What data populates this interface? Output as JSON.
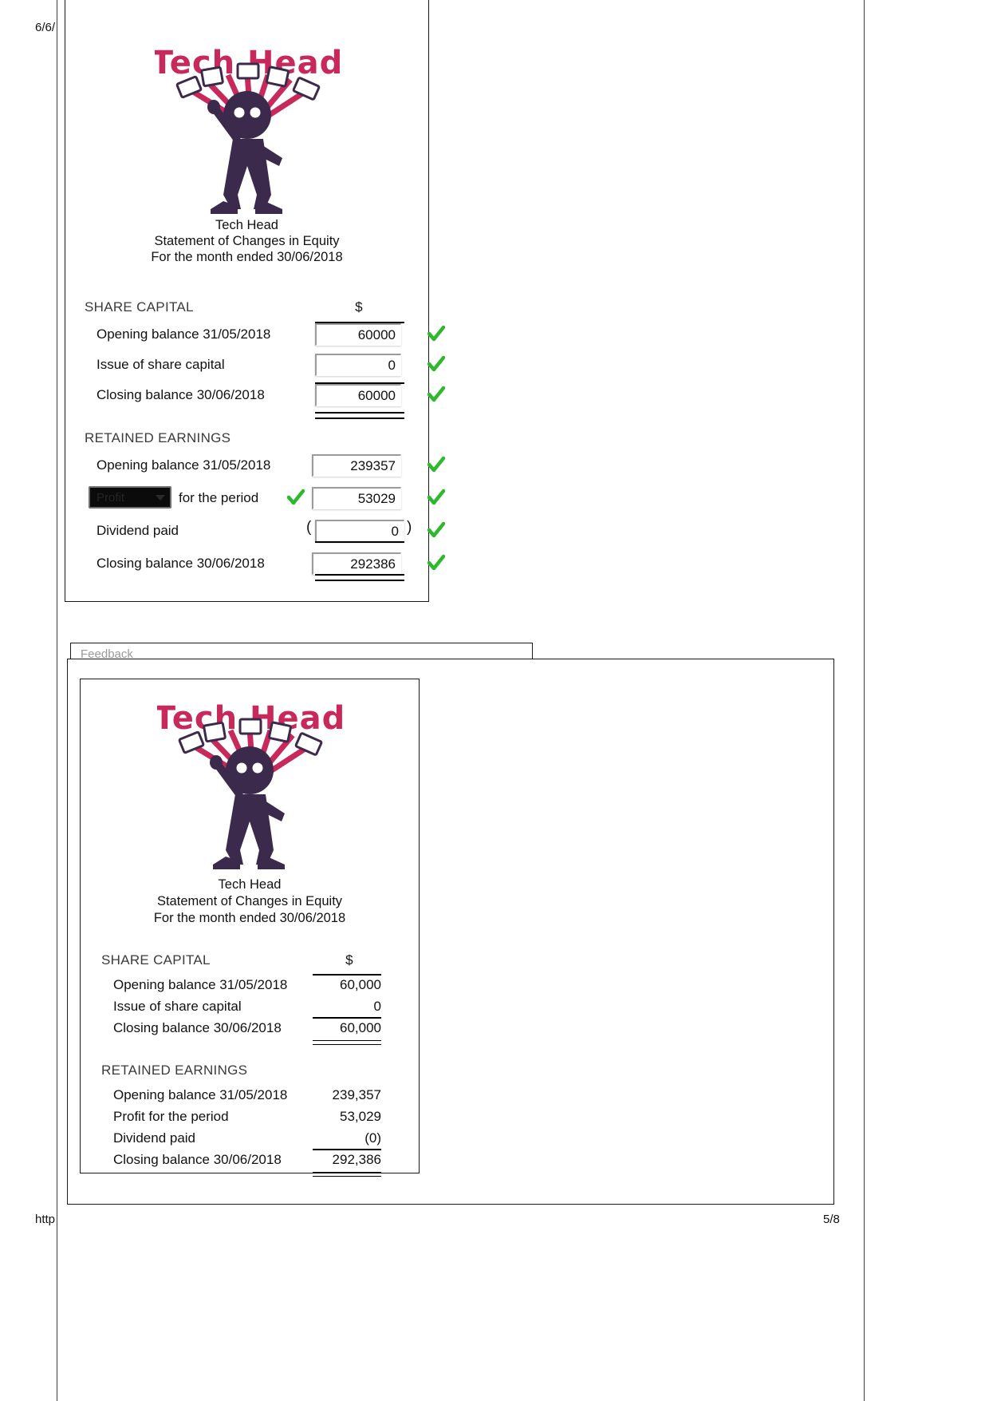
{
  "browser": {
    "header_date": "6/6/",
    "footer_url": "http",
    "page_number": "5/8"
  },
  "logo": {
    "wordmark": "Tech Head",
    "alt": "tech-head-logo"
  },
  "worksheet": {
    "title_line1": "Tech Head",
    "title_line2": "Statement of Changes in Equity",
    "title_line3": "For the month ended 30/06/2018",
    "currency_header": "$",
    "share_capital": {
      "heading": "SHARE CAPITAL",
      "rows": [
        {
          "label": "Opening balance 31/05/2018",
          "value": "60000",
          "tick": true
        },
        {
          "label": "Issue of share capital",
          "value": "0",
          "tick": true
        },
        {
          "label": "Closing balance 30/06/2018",
          "value": "60000",
          "tick": true
        }
      ]
    },
    "retained_earnings": {
      "heading": "RETAINED EARNINGS",
      "rows": [
        {
          "label": "Opening balance 31/05/2018",
          "value": "239357",
          "tick": true
        },
        {
          "label": "for the period",
          "value": "53029",
          "tick": true,
          "select_value": "Profit",
          "inline_tick": true
        },
        {
          "label": "Dividend paid",
          "value": "0",
          "tick": true,
          "parens": true
        },
        {
          "label": "Closing balance 30/06/2018",
          "value": "292386",
          "tick": true
        }
      ]
    }
  },
  "feedback": {
    "placeholder": "Feedback"
  },
  "solution": {
    "title_line1": "Tech Head",
    "title_line2": "Statement of Changes in Equity",
    "title_line3": "For the month ended 30/06/2018",
    "currency_header": "$",
    "share_capital": {
      "heading": "SHARE CAPITAL",
      "rows": [
        {
          "label": "Opening balance 31/05/2018",
          "value": "60,000"
        },
        {
          "label": "Issue of share capital",
          "value": "0"
        },
        {
          "label": "Closing balance 30/06/2018",
          "value": "60,000"
        }
      ]
    },
    "retained_earnings": {
      "heading": "RETAINED EARNINGS",
      "rows": [
        {
          "label": "Opening balance 31/05/2018",
          "value": "239,357"
        },
        {
          "label": "Profit for the period",
          "value": "53,029"
        },
        {
          "label": "Dividend paid",
          "value": "(0)"
        },
        {
          "label": "Closing balance 30/06/2018",
          "value": "292,386"
        }
      ]
    }
  },
  "colors": {
    "logo_red": "#c8285a",
    "logo_purple": "#3c2a4d",
    "tick_green": "#2eb82e",
    "rule": "#000000"
  }
}
